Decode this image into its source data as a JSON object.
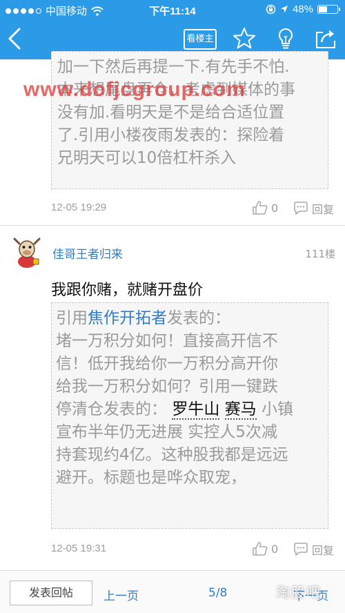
{
  "status_bar": {
    "carrier": "中国移动",
    "time": "下午11:14",
    "battery": "48%",
    "battery_level": 0.48
  },
  "nav": {
    "louzhu_label": "看楼主"
  },
  "watermark": "www.dofjcgroup.com",
  "post_prev": {
    "quote_lines": [
      "加一下然后再提一下.有先手不怕.",
      "本来想尾盘再仓，考虑到媒体的事",
      "没有加.看明天是不是给合适位置",
      "了.引用小楼夜雨发表的：探险着",
      "兄明天可以10倍杠杆杀入"
    ],
    "date": "12-05 19:29",
    "like_count": "0",
    "reply_label": "回复"
  },
  "post": {
    "username": "佳哥王者归来",
    "floor": "111楼",
    "text": "我跟你赌，就赌开盘价",
    "quote": {
      "prefix": "引用",
      "author": "焦作开拓者",
      "suffix": "发表的：",
      "line2": "堵一万积分如何！直接高开信不",
      "line3": "信！低开我给你一万积分高开你",
      "line4": "给我一万积分如何？引用一键跌",
      "line5_pre": "停清仓发表的：",
      "stock1": "罗牛山",
      "stock2": "赛马",
      "line5_post": "小镇",
      "line6": "宣布半年仍无进展 实控人5次减",
      "line7": "持套现约4亿。这种股我都是远远",
      "line8": "避开。标题也是哗众取宠，"
    },
    "date": "12-05 19:31",
    "like_count": "0",
    "reply_label": "回复"
  },
  "bottom_bar": {
    "reply_button": "发表回帖",
    "prev_label": "上一页",
    "page": "5/8",
    "next_label": "下一页"
  },
  "corner_watermark": "淘股吧",
  "colors": {
    "header": "#2b9be8",
    "link": "#2f7ec9",
    "quote_text": "#9a9a9a",
    "watermark": "#e23c3c"
  },
  "icons": [
    "back-icon",
    "star-icon",
    "lightbulb-icon",
    "share-icon",
    "like-icon",
    "comment-icon",
    "wifi-icon",
    "lock-rotation-icon",
    "location-icon",
    "battery-icon"
  ]
}
